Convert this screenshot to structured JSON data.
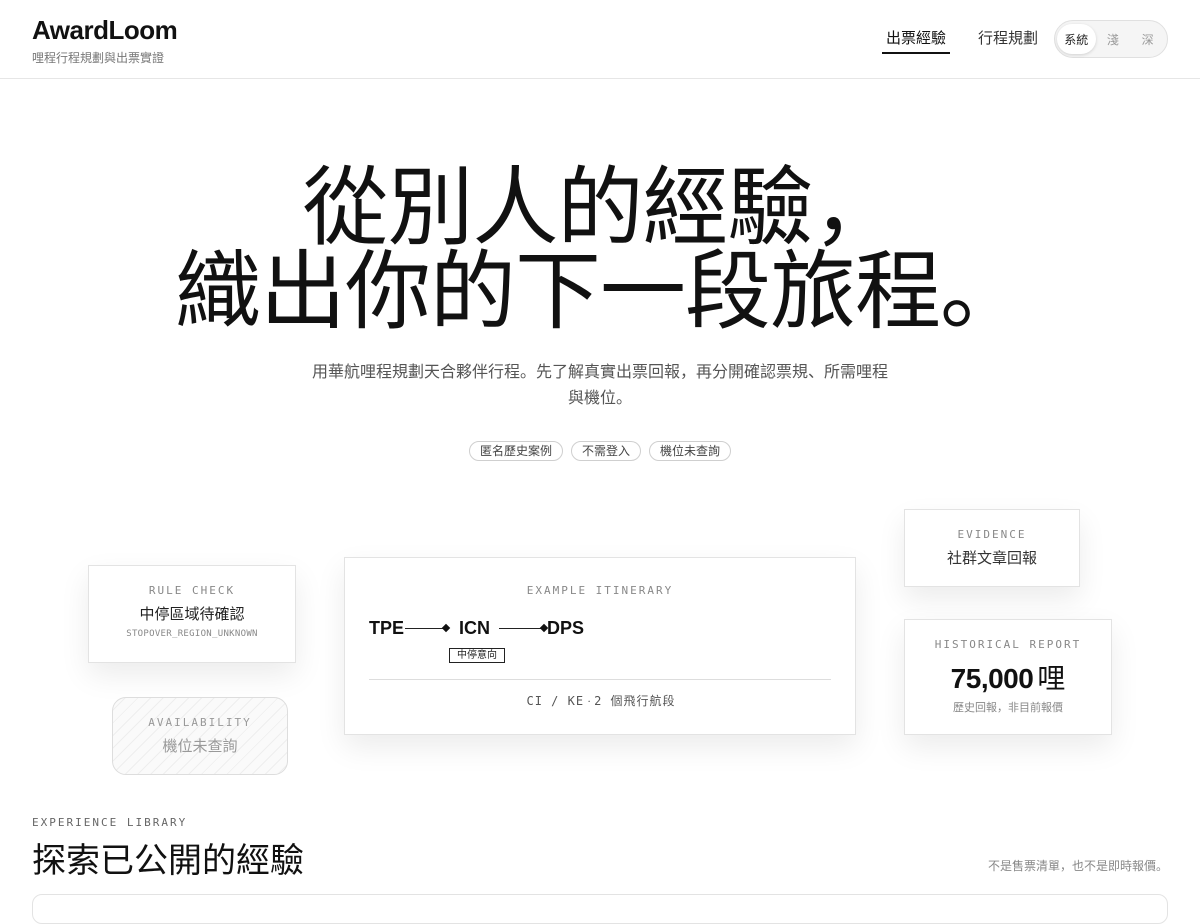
{
  "header": {
    "brand": "AwardLoom",
    "tagline": "哩程行程規劃與出票實證",
    "nav": [
      {
        "label": "出票經驗",
        "active": true
      },
      {
        "label": "行程規劃",
        "active": false
      }
    ],
    "theme": {
      "options": [
        "系統",
        "淺",
        "深"
      ],
      "selected": "系統"
    }
  },
  "hero": {
    "title_line1": "從別人的經驗，",
    "title_line2": "織出你的下一段旅程。",
    "subtitle": "用華航哩程規劃天合夥伴行程。先了解真實出票回報，再分開確認票規、所需哩程與機位。",
    "chips": [
      "匿名歷史案例",
      "不需登入",
      "機位未查詢"
    ]
  },
  "cards": {
    "rule_check": {
      "label": "RULE CHECK",
      "title": "中停區域待確認",
      "code": "STOPOVER_REGION_UNKNOWN"
    },
    "availability": {
      "label": "AVAILABILITY",
      "title": "機位未查詢"
    },
    "itinerary": {
      "label": "EXAMPLE ITINERARY",
      "airports": [
        "TPE",
        "ICN",
        "DPS"
      ],
      "stop_note": "中停意向",
      "carriers": "CI / KE",
      "separator": "·",
      "segments": "2 個飛行航段"
    },
    "evidence": {
      "label": "EVIDENCE",
      "title": "社群文章回報"
    },
    "report": {
      "label": "HISTORICAL REPORT",
      "miles": "75,000",
      "unit": "哩",
      "note": "歷史回報，非目前報價"
    }
  },
  "library": {
    "label": "EXPERIENCE LIBRARY",
    "title": "探索已公開的經驗",
    "note": "不是售票清單，也不是即時報價。"
  }
}
